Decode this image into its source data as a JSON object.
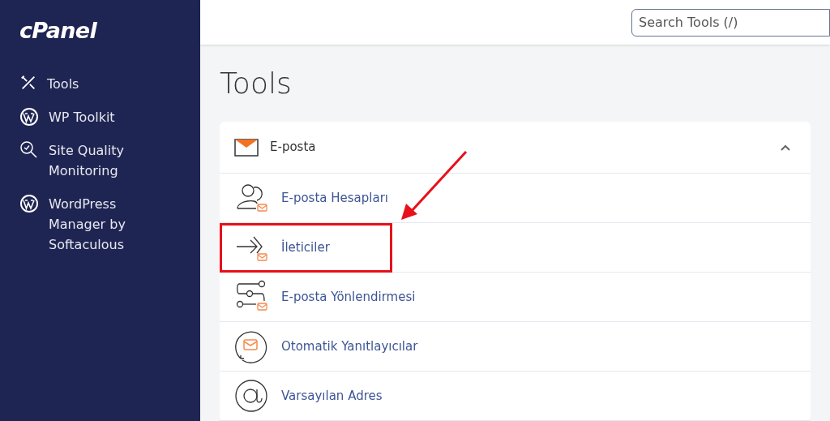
{
  "sidebar": {
    "logo": "cPanel",
    "items": [
      {
        "label": "Tools",
        "kind": "tools"
      },
      {
        "label": "WP Toolkit",
        "kind": "wordpress"
      },
      {
        "label": "Site Quality Monitoring",
        "kind": "quality"
      },
      {
        "label": "WordPress Manager by Softaculous",
        "kind": "wordpress"
      }
    ]
  },
  "search": {
    "placeholder": "Search Tools (/)"
  },
  "page_title": "Tools",
  "section": {
    "title": "E-posta",
    "expanded": true,
    "items": [
      {
        "label": "E-posta Hesapları",
        "kind": "accounts",
        "highlighted": false
      },
      {
        "label": "İleticiler",
        "kind": "forwarders",
        "highlighted": true
      },
      {
        "label": "E-posta Yönlendirmesi",
        "kind": "routing",
        "highlighted": false
      },
      {
        "label": "Otomatik Yanıtlayıcılar",
        "kind": "autoresponders",
        "highlighted": false
      },
      {
        "label": "Varsayılan Adres",
        "kind": "default",
        "highlighted": false
      }
    ]
  }
}
